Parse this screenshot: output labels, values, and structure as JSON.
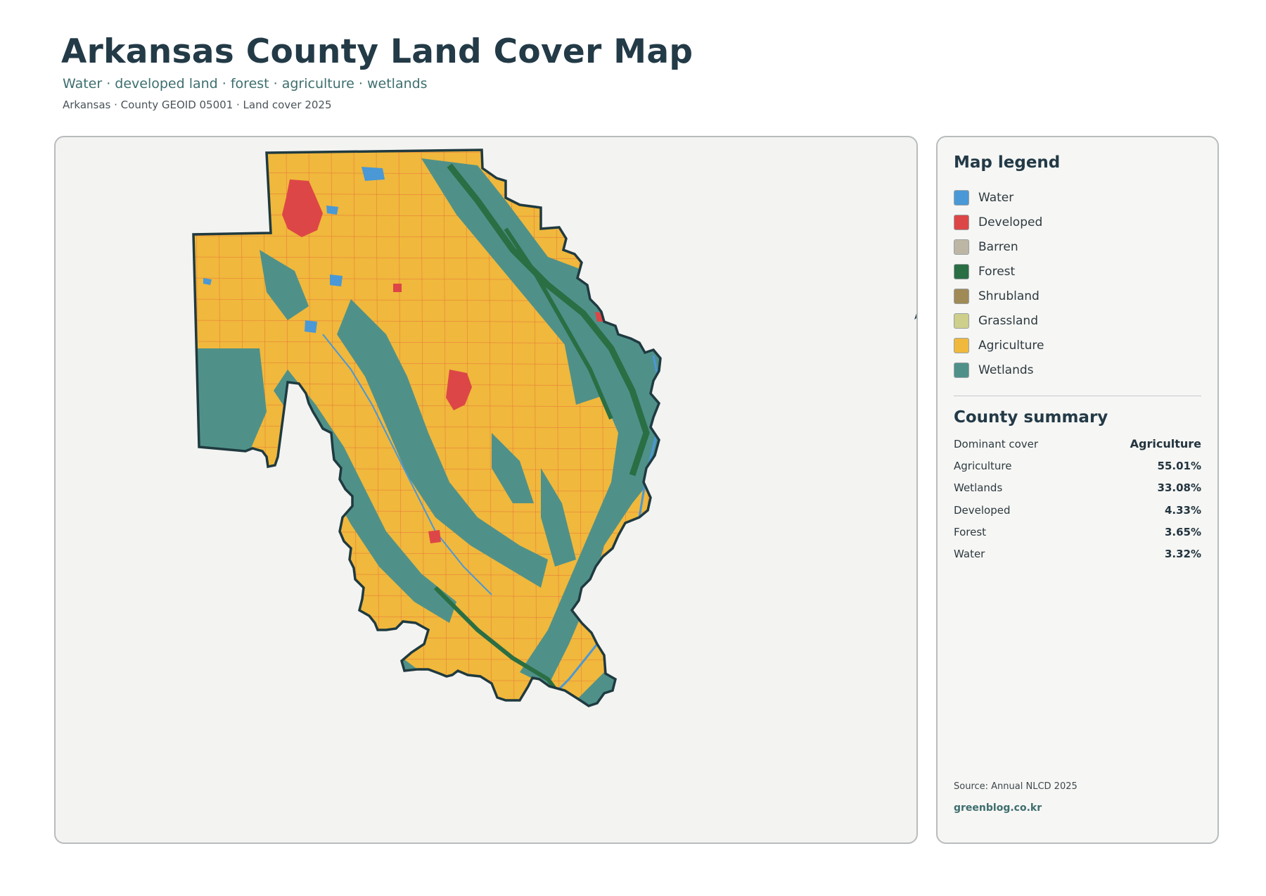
{
  "header": {
    "title": "Arkansas County Land Cover Map",
    "subtitle": "Water · developed land · forest · agriculture · wetlands",
    "caption": "Arkansas · County GEOID 05001 · Land cover 2025"
  },
  "map": {
    "north_label": "N",
    "colors": {
      "water": "#4a98d6",
      "developed": "#dd4646",
      "forest": "#2a6e44",
      "agriculture": "#f0b83c",
      "wetlands": "#4f9189",
      "outline": "#1f3a40",
      "roads": "#e2533c"
    }
  },
  "legend": {
    "heading": "Map legend",
    "items": [
      {
        "label": "Water",
        "color": "#4a98d6"
      },
      {
        "label": "Developed",
        "color": "#dd4646"
      },
      {
        "label": "Barren",
        "color": "#bdb6a5"
      },
      {
        "label": "Forest",
        "color": "#2a6e44"
      },
      {
        "label": "Shrubland",
        "color": "#a08a55"
      },
      {
        "label": "Grassland",
        "color": "#cdcf8a"
      },
      {
        "label": "Agriculture",
        "color": "#f0b83c"
      },
      {
        "label": "Wetlands",
        "color": "#4f9189"
      }
    ]
  },
  "summary": {
    "heading": "County summary",
    "rows": [
      {
        "label": "Dominant cover",
        "value": "Agriculture"
      },
      {
        "label": "Agriculture",
        "value": "55.01%"
      },
      {
        "label": "Wetlands",
        "value": "33.08%"
      },
      {
        "label": "Developed",
        "value": "4.33%"
      },
      {
        "label": "Forest",
        "value": "3.65%"
      },
      {
        "label": "Water",
        "value": "3.32%"
      }
    ]
  },
  "footer": {
    "source": "Source: Annual NLCD 2025",
    "credit": "greenblog.co.kr"
  }
}
